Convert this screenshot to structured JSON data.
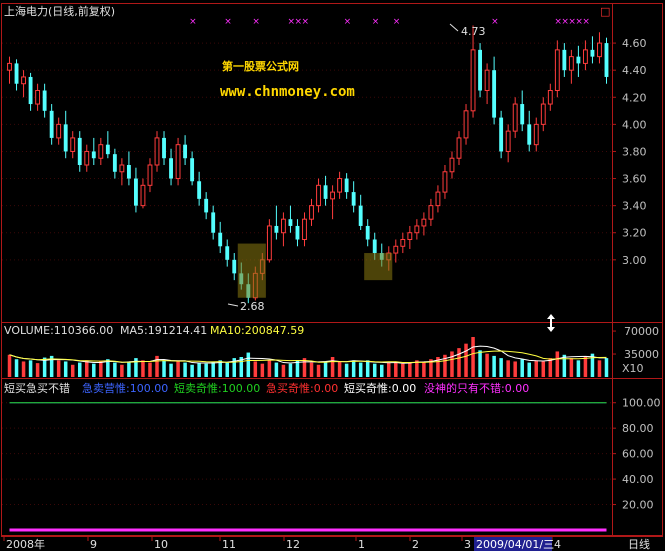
{
  "header": {
    "title": "上海电力(日线,前复权)",
    "watermark_line1": "第一股票公式网",
    "watermark_line2": "www.chnmoney.com",
    "corner_box": "□"
  },
  "annotations": {
    "high_label": "4.73",
    "low_label": "2.68"
  },
  "volume_panel": {
    "label_volume": "VOLUME:110366.00",
    "label_ma5": "MA5:191214.41",
    "label_ma10": "MA10:200847.59",
    "axis_unit": "X10"
  },
  "indicator_panel": {
    "name": "短买急买不错",
    "legend": [
      {
        "text": "急卖营惟:100.00",
        "color": "#3c64ff"
      },
      {
        "text": "短卖奇惟:100.00",
        "color": "#20d020"
      },
      {
        "text": "急买奇惟:0.00",
        "color": "#ff3030"
      },
      {
        "text": "短买奇惟:0.00",
        "color": "#ffffff"
      },
      {
        "text": "没神的只有不错:0.00",
        "color": "#ff30ff"
      }
    ]
  },
  "bottom_bar": {
    "dates": [
      "2008年",
      "9",
      "10",
      "11",
      "12",
      "1",
      "2",
      "3",
      "4"
    ],
    "cursor_date": "2009/04/01/三",
    "period": "日线"
  },
  "colors": {
    "up": "#ff3c3c",
    "down": "#54ffff",
    "frame": "#b01818",
    "axis_text": "#c0c0c0",
    "ma5": "#ffffff",
    "ma10": "#ffff40",
    "magenta": "#ff30ff",
    "gold": "#ffd700"
  },
  "chart_data": [
    {
      "type": "candlestick",
      "title": "上海电力(日线,前复权)",
      "y_ticks": [
        3.0,
        3.2,
        3.4,
        3.6,
        3.8,
        4.0,
        4.2,
        4.4,
        4.6
      ],
      "ylim": [
        2.6,
        4.8
      ],
      "annotated_high": 4.73,
      "annotated_low": 2.68,
      "ohlc": [
        [
          4.4,
          4.5,
          4.3,
          4.45
        ],
        [
          4.45,
          4.48,
          4.25,
          4.3
        ],
        [
          4.3,
          4.4,
          4.2,
          4.35
        ],
        [
          4.35,
          4.38,
          4.1,
          4.15
        ],
        [
          4.15,
          4.3,
          4.1,
          4.25
        ],
        [
          4.25,
          4.3,
          4.05,
          4.1
        ],
        [
          4.1,
          4.15,
          3.85,
          3.9
        ],
        [
          3.9,
          4.05,
          3.85,
          4.0
        ],
        [
          4.0,
          4.1,
          3.75,
          3.8
        ],
        [
          3.8,
          3.95,
          3.75,
          3.9
        ],
        [
          3.9,
          3.95,
          3.65,
          3.7
        ],
        [
          3.7,
          3.85,
          3.65,
          3.8
        ],
        [
          3.8,
          3.9,
          3.7,
          3.75
        ],
        [
          3.75,
          3.9,
          3.7,
          3.85
        ],
        [
          3.85,
          3.95,
          3.75,
          3.78
        ],
        [
          3.78,
          3.82,
          3.6,
          3.65
        ],
        [
          3.65,
          3.75,
          3.55,
          3.7
        ],
        [
          3.7,
          3.8,
          3.55,
          3.6
        ],
        [
          3.6,
          3.68,
          3.35,
          3.4
        ],
        [
          3.4,
          3.6,
          3.38,
          3.55
        ],
        [
          3.55,
          3.75,
          3.5,
          3.7
        ],
        [
          3.7,
          3.95,
          3.65,
          3.9
        ],
        [
          3.9,
          3.95,
          3.7,
          3.75
        ],
        [
          3.75,
          3.82,
          3.55,
          3.6
        ],
        [
          3.6,
          3.9,
          3.55,
          3.85
        ],
        [
          3.85,
          3.92,
          3.7,
          3.75
        ],
        [
          3.75,
          3.8,
          3.55,
          3.58
        ],
        [
          3.58,
          3.65,
          3.4,
          3.45
        ],
        [
          3.45,
          3.5,
          3.3,
          3.35
        ],
        [
          3.35,
          3.4,
          3.15,
          3.2
        ],
        [
          3.2,
          3.28,
          3.05,
          3.1
        ],
        [
          3.1,
          3.15,
          2.95,
          3.0
        ],
        [
          3.0,
          3.05,
          2.85,
          2.9
        ],
        [
          2.9,
          2.98,
          2.78,
          2.82
        ],
        [
          2.82,
          2.9,
          2.68,
          2.72
        ],
        [
          2.72,
          2.95,
          2.7,
          2.9
        ],
        [
          2.9,
          3.05,
          2.85,
          3.0
        ],
        [
          3.0,
          3.3,
          2.98,
          3.25
        ],
        [
          3.25,
          3.4,
          3.15,
          3.2
        ],
        [
          3.2,
          3.35,
          3.1,
          3.3
        ],
        [
          3.3,
          3.4,
          3.2,
          3.25
        ],
        [
          3.25,
          3.3,
          3.1,
          3.15
        ],
        [
          3.15,
          3.35,
          3.1,
          3.3
        ],
        [
          3.3,
          3.45,
          3.25,
          3.4
        ],
        [
          3.4,
          3.6,
          3.35,
          3.55
        ],
        [
          3.55,
          3.62,
          3.4,
          3.45
        ],
        [
          3.45,
          3.55,
          3.3,
          3.5
        ],
        [
          3.5,
          3.65,
          3.45,
          3.6
        ],
        [
          3.6,
          3.64,
          3.45,
          3.5
        ],
        [
          3.5,
          3.58,
          3.35,
          3.4
        ],
        [
          3.4,
          3.48,
          3.22,
          3.25
        ],
        [
          3.25,
          3.3,
          3.1,
          3.15
        ],
        [
          3.15,
          3.2,
          3.0,
          3.05
        ],
        [
          3.05,
          3.12,
          2.95,
          3.0
        ],
        [
          3.0,
          3.1,
          2.92,
          3.05
        ],
        [
          3.05,
          3.15,
          2.98,
          3.1
        ],
        [
          3.1,
          3.2,
          3.05,
          3.15
        ],
        [
          3.15,
          3.25,
          3.08,
          3.2
        ],
        [
          3.2,
          3.3,
          3.15,
          3.25
        ],
        [
          3.25,
          3.35,
          3.18,
          3.3
        ],
        [
          3.3,
          3.45,
          3.25,
          3.4
        ],
        [
          3.4,
          3.55,
          3.35,
          3.5
        ],
        [
          3.5,
          3.7,
          3.45,
          3.65
        ],
        [
          3.65,
          3.8,
          3.6,
          3.75
        ],
        [
          3.75,
          3.95,
          3.7,
          3.9
        ],
        [
          3.9,
          4.15,
          3.85,
          4.1
        ],
        [
          4.1,
          4.73,
          4.05,
          4.55
        ],
        [
          4.55,
          4.6,
          4.2,
          4.25
        ],
        [
          4.25,
          4.45,
          4.15,
          4.4
        ],
        [
          4.4,
          4.5,
          4.0,
          4.05
        ],
        [
          4.05,
          4.1,
          3.75,
          3.8
        ],
        [
          3.8,
          4.0,
          3.72,
          3.95
        ],
        [
          3.95,
          4.2,
          3.9,
          4.15
        ],
        [
          4.15,
          4.25,
          3.95,
          4.0
        ],
        [
          4.0,
          4.1,
          3.8,
          3.85
        ],
        [
          3.85,
          4.05,
          3.8,
          4.0
        ],
        [
          4.0,
          4.2,
          3.95,
          4.15
        ],
        [
          4.15,
          4.3,
          4.1,
          4.25
        ],
        [
          4.25,
          4.62,
          4.2,
          4.55
        ],
        [
          4.55,
          4.6,
          4.35,
          4.4
        ],
        [
          4.4,
          4.55,
          4.3,
          4.5
        ],
        [
          4.5,
          4.58,
          4.35,
          4.45
        ],
        [
          4.45,
          4.62,
          4.4,
          4.55
        ],
        [
          4.55,
          4.65,
          4.45,
          4.5
        ],
        [
          4.5,
          4.68,
          4.45,
          4.6
        ],
        [
          4.6,
          4.64,
          4.3,
          4.35
        ]
      ]
    },
    {
      "type": "bar",
      "title": "VOLUME",
      "y_ticks": [
        35000,
        70000
      ],
      "unit": "X10",
      "values": [
        40,
        32,
        28,
        30,
        25,
        35,
        38,
        30,
        28,
        22,
        26,
        30,
        24,
        28,
        32,
        26,
        22,
        28,
        34,
        30,
        26,
        38,
        30,
        24,
        28,
        26,
        22,
        26,
        24,
        28,
        30,
        26,
        34,
        36,
        44,
        28,
        24,
        30,
        26,
        22,
        24,
        30,
        34,
        26,
        22,
        28,
        36,
        28,
        24,
        30,
        26,
        30,
        24,
        22,
        26,
        28,
        24,
        26,
        30,
        28,
        32,
        36,
        40,
        46,
        52,
        60,
        72,
        48,
        42,
        38,
        34,
        30,
        28,
        32,
        26,
        30,
        28,
        34,
        46,
        40,
        34,
        30,
        36,
        42,
        30,
        34
      ]
    },
    {
      "type": "line",
      "title": "短买急买不错",
      "y_ticks": [
        20.0,
        40.0,
        60.0,
        80.0,
        100.0
      ],
      "ylim": [
        0,
        110
      ],
      "series": [
        {
          "name": "急卖营惟",
          "color": "#3c64ff",
          "values": [
            100,
            100,
            100,
            100,
            100,
            100,
            100,
            100,
            100,
            100,
            100,
            100,
            100,
            100,
            100,
            100,
            100,
            100,
            100,
            100,
            100,
            100,
            100,
            100,
            100,
            100,
            100,
            100,
            100,
            100,
            100,
            100,
            100,
            100,
            100,
            100,
            100,
            100,
            100,
            100,
            100,
            100,
            100,
            100,
            100,
            100,
            100,
            100,
            100,
            100,
            100,
            100,
            100,
            100,
            100,
            100,
            100,
            100,
            100,
            100,
            100,
            100,
            100,
            100,
            100,
            100,
            100,
            100,
            100,
            100,
            100,
            100,
            100,
            100,
            100,
            100,
            100,
            100,
            100,
            100,
            100,
            100,
            100,
            100,
            100,
            100
          ]
        },
        {
          "name": "短卖奇惟",
          "color": "#20d020",
          "values": [
            100,
            100,
            100,
            100,
            100,
            100,
            100,
            100,
            100,
            100,
            100,
            100,
            100,
            100,
            100,
            100,
            100,
            100,
            100,
            100,
            100,
            100,
            100,
            100,
            100,
            100,
            100,
            100,
            100,
            100,
            100,
            100,
            100,
            100,
            100,
            100,
            100,
            100,
            100,
            100,
            100,
            100,
            100,
            100,
            100,
            100,
            100,
            100,
            100,
            100,
            100,
            100,
            100,
            100,
            100,
            100,
            100,
            100,
            100,
            100,
            100,
            100,
            100,
            100,
            100,
            100,
            100,
            100,
            100,
            100,
            100,
            100,
            100,
            100,
            100,
            100,
            100,
            100,
            100,
            100,
            100,
            100,
            100,
            100,
            100,
            100
          ]
        },
        {
          "name": "急买奇惟",
          "color": "#ff3030",
          "values": [
            0,
            0,
            0,
            0,
            0,
            0,
            0,
            0,
            0,
            0,
            0,
            0,
            0,
            0,
            0,
            0,
            0,
            0,
            0,
            0,
            0,
            0,
            0,
            0,
            0,
            0,
            0,
            0,
            0,
            0,
            0,
            0,
            0,
            0,
            0,
            0,
            0,
            0,
            0,
            0,
            0,
            0,
            0,
            0,
            0,
            0,
            0,
            0,
            0,
            0,
            0,
            0,
            0,
            0,
            0,
            0,
            0,
            0,
            0,
            0,
            0,
            0,
            0,
            0,
            0,
            0,
            0,
            0,
            0,
            0,
            0,
            0,
            0,
            0,
            0,
            0,
            0,
            0,
            0,
            0,
            0,
            0,
            0,
            0,
            0,
            0
          ]
        },
        {
          "name": "短买奇惟",
          "color": "#ffffff",
          "values": [
            0,
            0,
            0,
            0,
            0,
            0,
            0,
            0,
            0,
            0,
            0,
            0,
            0,
            0,
            0,
            0,
            0,
            0,
            0,
            0,
            0,
            0,
            0,
            0,
            0,
            0,
            0,
            0,
            0,
            0,
            0,
            0,
            0,
            0,
            0,
            0,
            0,
            0,
            0,
            0,
            0,
            0,
            0,
            0,
            0,
            0,
            0,
            0,
            0,
            0,
            0,
            0,
            0,
            0,
            0,
            0,
            0,
            0,
            0,
            0,
            0,
            0,
            0,
            0,
            0,
            0,
            0,
            0,
            0,
            0,
            0,
            0,
            0,
            0,
            0,
            0,
            0,
            0,
            0,
            0,
            0,
            0,
            0,
            0,
            0,
            0
          ]
        },
        {
          "name": "没神的只有不错",
          "color": "#ff30ff",
          "values": [
            0,
            0,
            0,
            0,
            0,
            0,
            0,
            0,
            0,
            0,
            0,
            0,
            0,
            0,
            0,
            0,
            0,
            0,
            0,
            0,
            0,
            0,
            0,
            0,
            0,
            0,
            0,
            0,
            0,
            0,
            0,
            0,
            0,
            0,
            0,
            0,
            0,
            0,
            0,
            0,
            0,
            0,
            0,
            0,
            0,
            0,
            0,
            0,
            0,
            0,
            0,
            0,
            0,
            0,
            0,
            0,
            0,
            0,
            0,
            0,
            0,
            0,
            0,
            0,
            0,
            0,
            0,
            0,
            0,
            0,
            0,
            0,
            0,
            0,
            0,
            0,
            0,
            0,
            0,
            0,
            0,
            0,
            0,
            0,
            0,
            0
          ]
        }
      ]
    }
  ]
}
